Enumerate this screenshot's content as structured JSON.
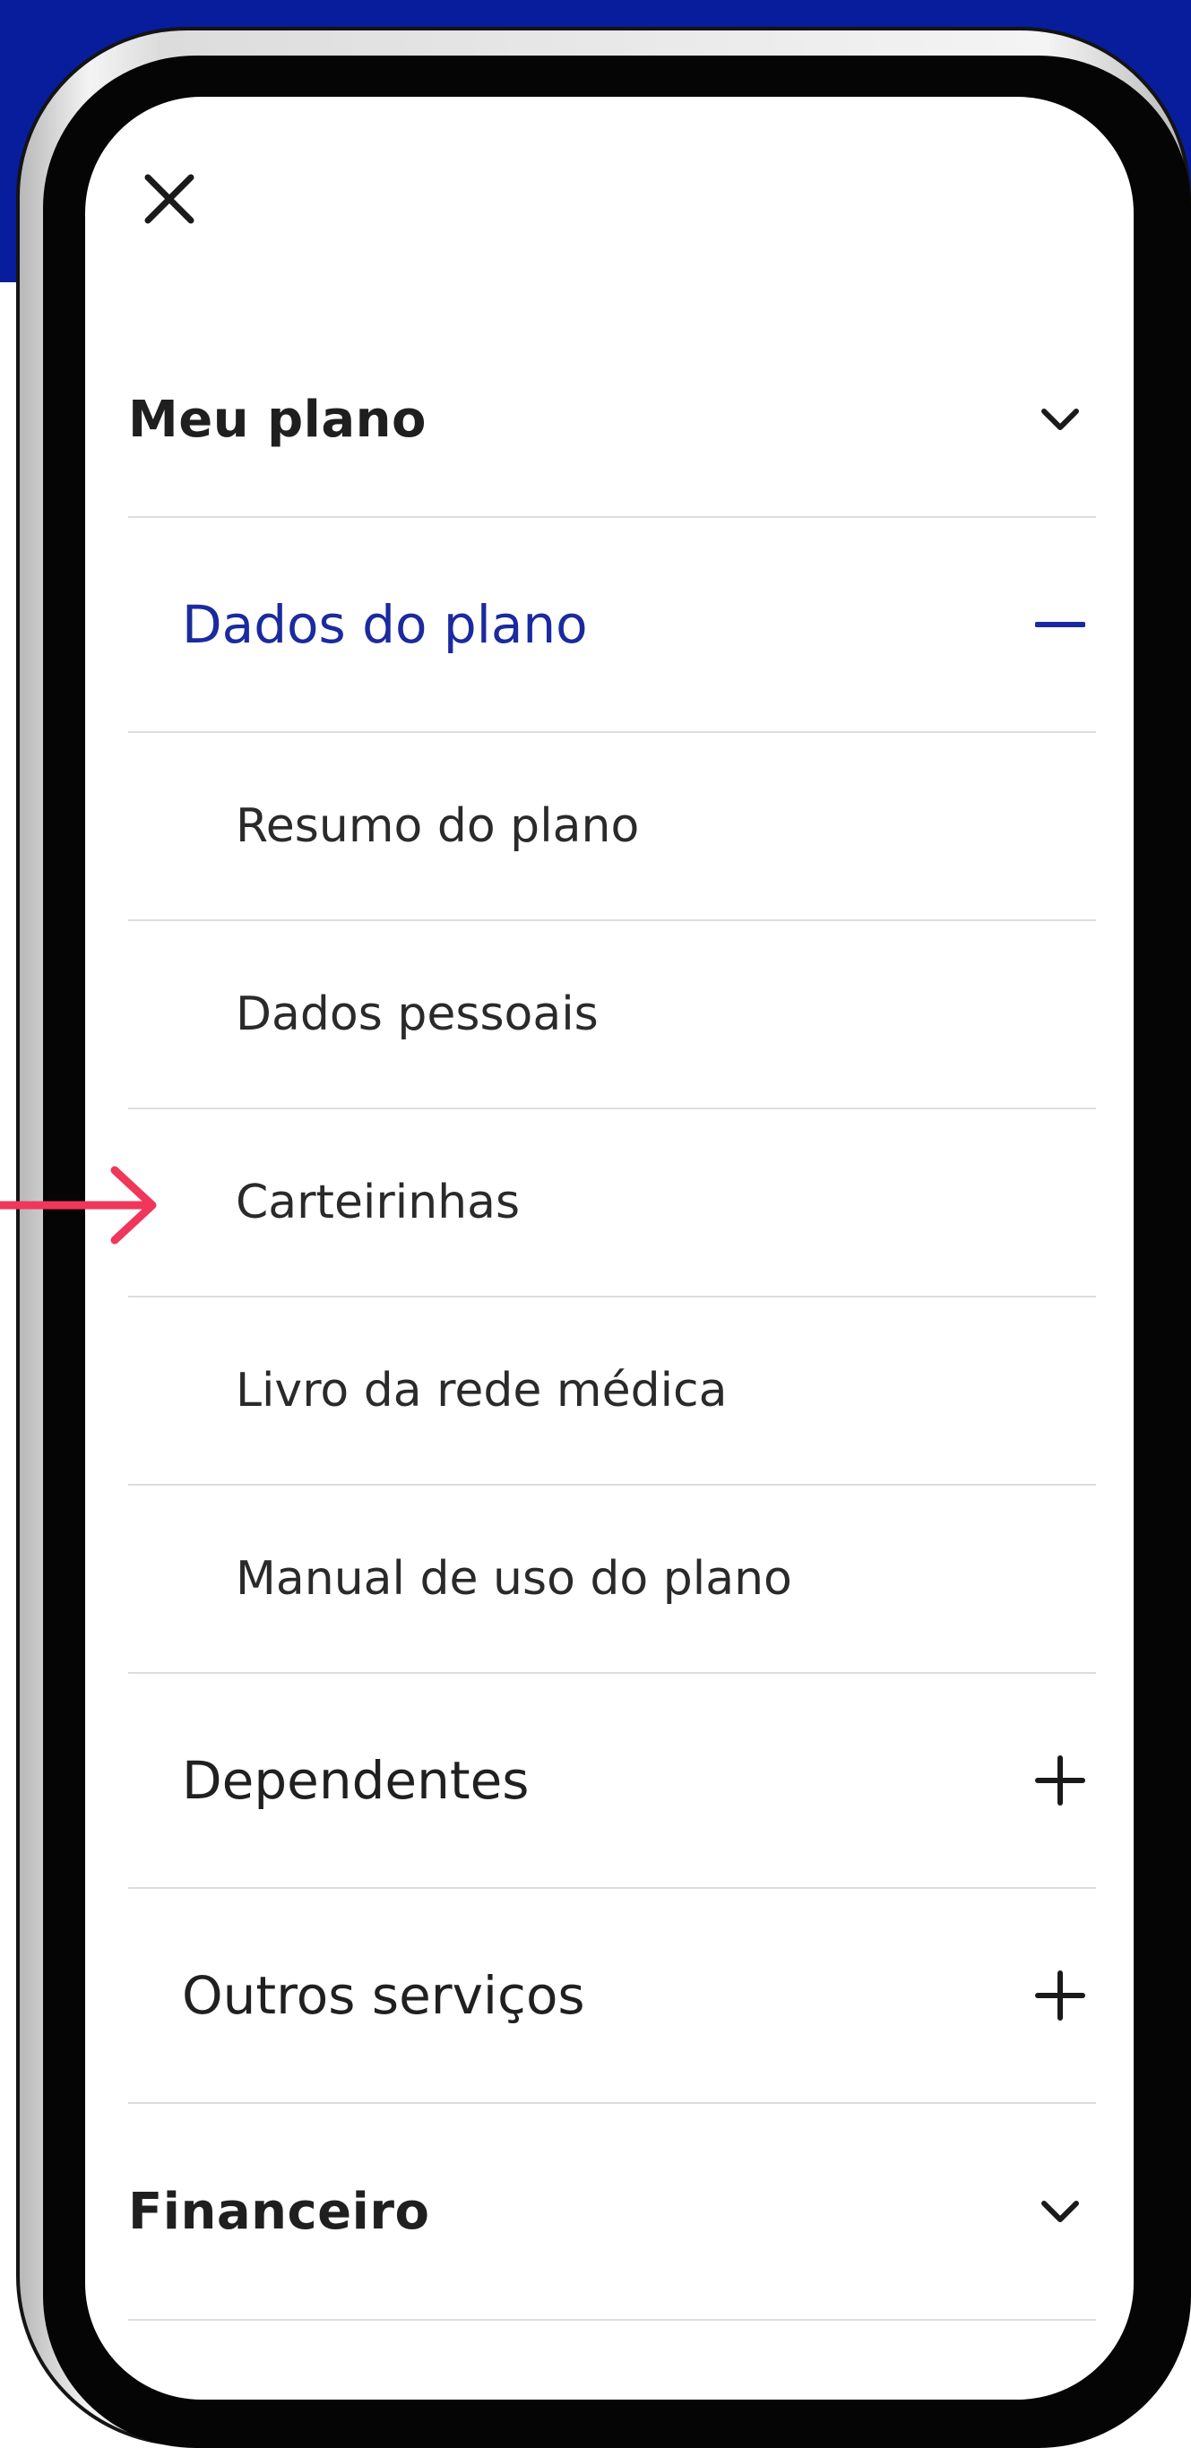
{
  "theme": {
    "banner_color": "#071d9b",
    "active_color": "#1b2a9e",
    "arrow_color": "#f0365a"
  },
  "menu": {
    "close_icon": "close-icon",
    "sections": [
      {
        "label": "Meu plano",
        "icon": "chevron-down-icon",
        "groups": [
          {
            "label": "Dados do plano",
            "icon": "minus-icon",
            "active": true,
            "items": [
              "Resumo do plano",
              "Dados pessoais",
              "Carteirinhas",
              "Livro da rede médica",
              "Manual de uso do plano"
            ]
          },
          {
            "label": "Dependentes",
            "icon": "plus-icon",
            "active": false
          },
          {
            "label": "Outros serviços",
            "icon": "plus-icon",
            "active": false
          }
        ]
      },
      {
        "label": "Financeiro",
        "icon": "chevron-down-icon"
      }
    ]
  },
  "annotation": {
    "pointer_icon": "arrow-right-icon",
    "points_to": "Carteirinhas"
  }
}
